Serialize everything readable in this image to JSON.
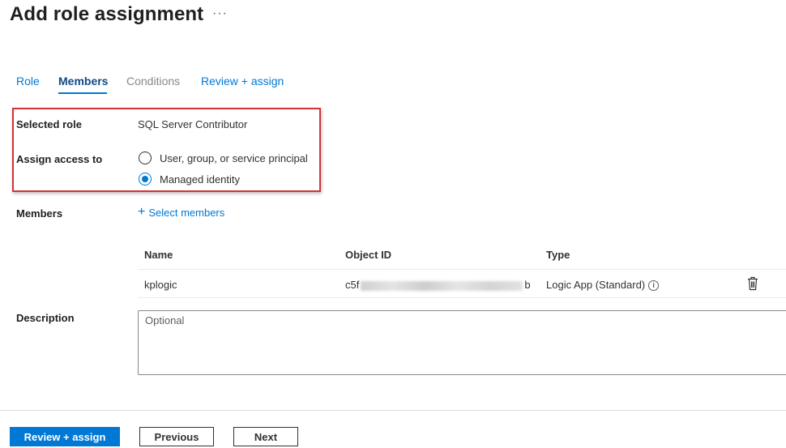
{
  "header": {
    "title": "Add role assignment",
    "more_label": "···"
  },
  "tabs": [
    {
      "label": "Role",
      "state": "normal"
    },
    {
      "label": "Members",
      "state": "active"
    },
    {
      "label": "Conditions",
      "state": "disabled"
    },
    {
      "label": "Review + assign",
      "state": "normal"
    }
  ],
  "form": {
    "selected_role_label": "Selected role",
    "selected_role_value": "SQL Server Contributor",
    "assign_access_label": "Assign access to",
    "assign_options": [
      {
        "label": "User, group, or service principal",
        "checked": false
      },
      {
        "label": "Managed identity",
        "checked": true
      }
    ],
    "members_label": "Members",
    "select_members_label": "Select members",
    "description_label": "Description",
    "description_placeholder": "Optional",
    "description_value": ""
  },
  "members_table": {
    "columns": [
      "Name",
      "Object ID",
      "Type"
    ],
    "rows": [
      {
        "name": "kplogic",
        "object_id_prefix": "c5f",
        "object_id_suffix": "b",
        "object_id_redacted": true,
        "type": "Logic App (Standard)"
      }
    ]
  },
  "icons": {
    "plus": "plus-icon",
    "info": "info-icon",
    "delete": "trash-icon"
  },
  "footer": {
    "review_assign_label": "Review + assign",
    "previous_label": "Previous",
    "next_label": "Next"
  },
  "colors": {
    "accent": "#0078d4",
    "highlight_border": "#d13438",
    "text": "#323130"
  }
}
